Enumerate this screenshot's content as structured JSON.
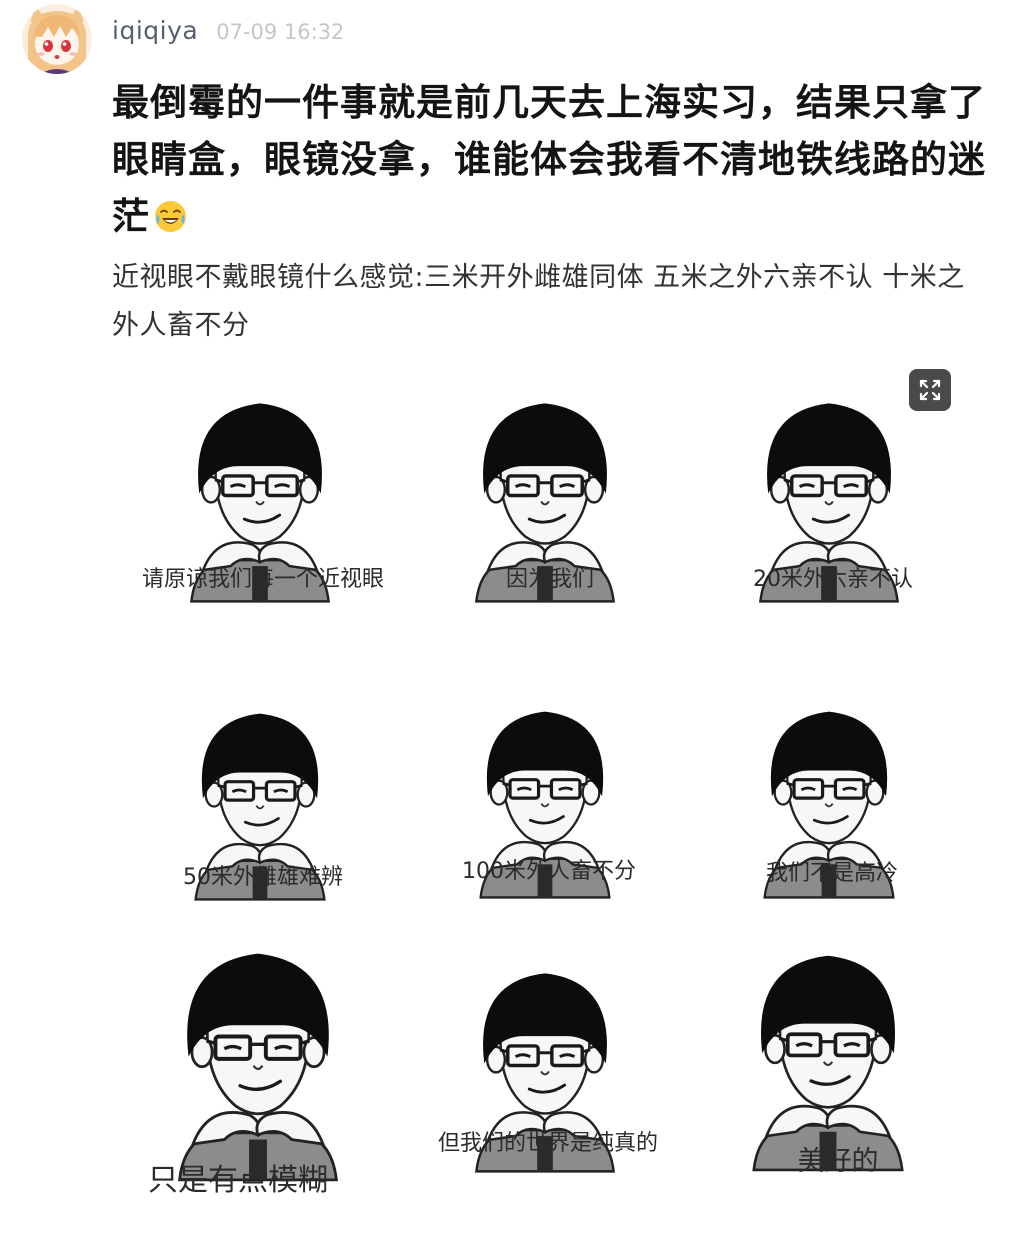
{
  "post": {
    "author": "iqiqiya",
    "time": "07-09 16:32",
    "title": "最倒霉的一件事就是前几天去上海实习，结果只拿了眼睛盒，眼镜没拿，谁能体会我看不清地铁线路的迷茫",
    "title_emoji": "laughing-with-tears-emoji",
    "body": "近视眼不戴眼镜什么感觉:三米开外雌雄同体 五米之外六亲不认 十米之外人畜不分"
  },
  "image": {
    "expand_icon": "expand-icon",
    "panels": [
      {
        "caption": "请原谅我们每一个近视眼"
      },
      {
        "caption": "因为我们"
      },
      {
        "caption": "20米外六亲不认"
      },
      {
        "caption": "50米外雌雄难辨"
      },
      {
        "caption": "100米外人畜不分"
      },
      {
        "caption": "我们不是高冷"
      },
      {
        "caption": "只是有点模糊"
      },
      {
        "caption": "但我们的世界是纯真的"
      },
      {
        "caption": "美好的"
      }
    ]
  },
  "colors": {
    "author": "#555f6e",
    "time": "#c3c7cc",
    "title": "#141414",
    "body": "#333333",
    "expand_button_bg": "#4a4a4a"
  }
}
